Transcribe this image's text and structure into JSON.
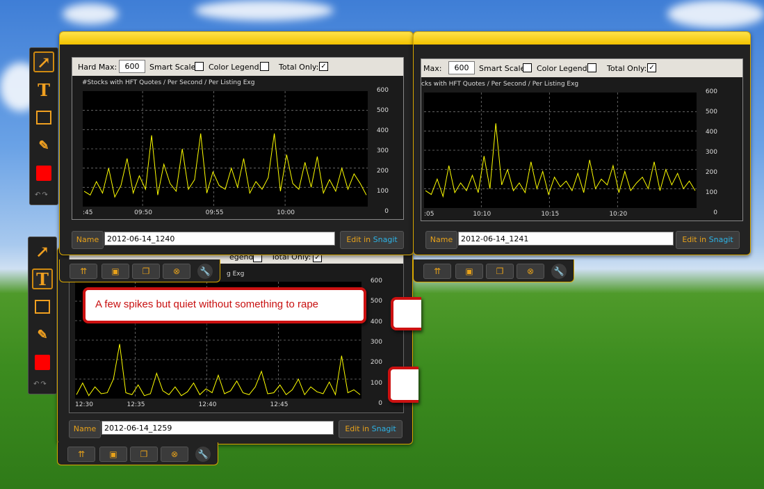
{
  "window_a": {
    "hard_max_label": "Hard Max:",
    "hard_max_value": "600",
    "smart_scale_label": "Smart Scale:",
    "color_legend_label": "Color Legend:",
    "total_only_label": "Total Only:",
    "total_only_check": "✓",
    "chart_title": "#Stocks with HFT Quotes / Per Second / Per Listing Exg",
    "y_ticks": [
      "600",
      "500",
      "400",
      "300",
      "200",
      "100",
      "0"
    ],
    "x_ticks": [
      ":45",
      "09:50",
      "09:55",
      "10:00"
    ],
    "name_label": "Name",
    "name_value": "2012-06-14_1240",
    "edit_in": "Edit in ",
    "snagit": "Snagit"
  },
  "window_b": {
    "hard_max_label": "Max:",
    "hard_max_value": "600",
    "smart_scale_label": "Smart Scale:",
    "color_legend_label": "Color Legend:",
    "total_only_label": "Total Only:",
    "total_only_check": "✓",
    "chart_title": "cks with HFT Quotes / Per Second / Per Listing Exg",
    "y_ticks": [
      "600",
      "500",
      "400",
      "300",
      "200",
      "100",
      "0"
    ],
    "x_ticks": ":05|10:10|10:15|10:20",
    "name_label": "Name",
    "name_value": "2012-06-14_1241",
    "edit_in": "Edit in ",
    "snagit": "Snagit"
  },
  "window_c": {
    "header_fragment_1": "egend:",
    "header_fragment_2": "Total Only:",
    "chart_title": "g Exg",
    "y_ticks": [
      "600",
      "500",
      "400",
      "300",
      "200",
      "100",
      "0"
    ],
    "x_ticks": [
      "12:30",
      "12:35",
      "12:40",
      "12:45"
    ],
    "name_label": "Name",
    "name_value": "2012-06-14_1259",
    "edit_in": "Edit in ",
    "snagit": "Snagit"
  },
  "callout": {
    "text": "A few spikes but quiet without something to rape"
  },
  "icons": {
    "arrow": "arrow-icon",
    "text": "text-tool-icon",
    "rect": "rectangle-icon",
    "highlighter": "highlighter-icon",
    "color": "color-swatch-icon",
    "share": "share-icon",
    "save": "save-icon",
    "copy": "copy-icon",
    "close": "close-icon",
    "settings": "wrench-icon"
  },
  "colors": {
    "accent": "#e8a21a",
    "trace": "#ffff00",
    "callout_border": "#cc1111",
    "snagit": "#2db3e6"
  },
  "chart_data": [
    {
      "type": "line",
      "title": "#Stocks with HFT Quotes / Per Second / Per Listing Exg",
      "x_ticks": [
        ":45",
        "09:50",
        "09:55",
        "10:00"
      ],
      "ylim": [
        0,
        600
      ],
      "series": [
        {
          "values": [
            80,
            60,
            130,
            70,
            200,
            50,
            110,
            250,
            70,
            160,
            90,
            370,
            60,
            220,
            120,
            80,
            300,
            90,
            140,
            380,
            70,
            180,
            110,
            90,
            200,
            100,
            250,
            70,
            130,
            90,
            150,
            380,
            80,
            270,
            120,
            90,
            230,
            100,
            260,
            70,
            140,
            80,
            200,
            90,
            170,
            120,
            60
          ]
        }
      ]
    },
    {
      "type": "line",
      "title": "cks with HFT Quotes / Per Second / Per Listing Exg",
      "x_ticks": [
        ":05",
        "10:10",
        "10:15",
        "10:20"
      ],
      "ylim": [
        0,
        600
      ],
      "series": [
        {
          "values": [
            90,
            70,
            150,
            60,
            220,
            80,
            130,
            90,
            170,
            80,
            270,
            100,
            440,
            120,
            200,
            90,
            130,
            80,
            240,
            100,
            190,
            70,
            160,
            110,
            140,
            90,
            180,
            80,
            250,
            100,
            150,
            120,
            220,
            80,
            190,
            90,
            130,
            160,
            100,
            240,
            90,
            200,
            120,
            180,
            100,
            140,
            90
          ]
        }
      ]
    },
    {
      "type": "line",
      "title": "g Exg",
      "x_ticks": [
        "12:30",
        "12:35",
        "12:40",
        "12:45"
      ],
      "ylim": [
        0,
        600
      ],
      "series": [
        {
          "values": [
            20,
            80,
            15,
            60,
            25,
            30,
            100,
            280,
            30,
            20,
            70,
            15,
            25,
            130,
            40,
            20,
            60,
            15,
            35,
            80,
            20,
            50,
            30,
            120,
            25,
            40,
            90,
            30,
            20,
            60,
            140,
            25,
            30,
            70,
            20,
            45,
            100,
            20,
            60,
            35,
            25,
            85,
            20,
            220,
            30,
            45,
            20
          ]
        }
      ]
    }
  ]
}
